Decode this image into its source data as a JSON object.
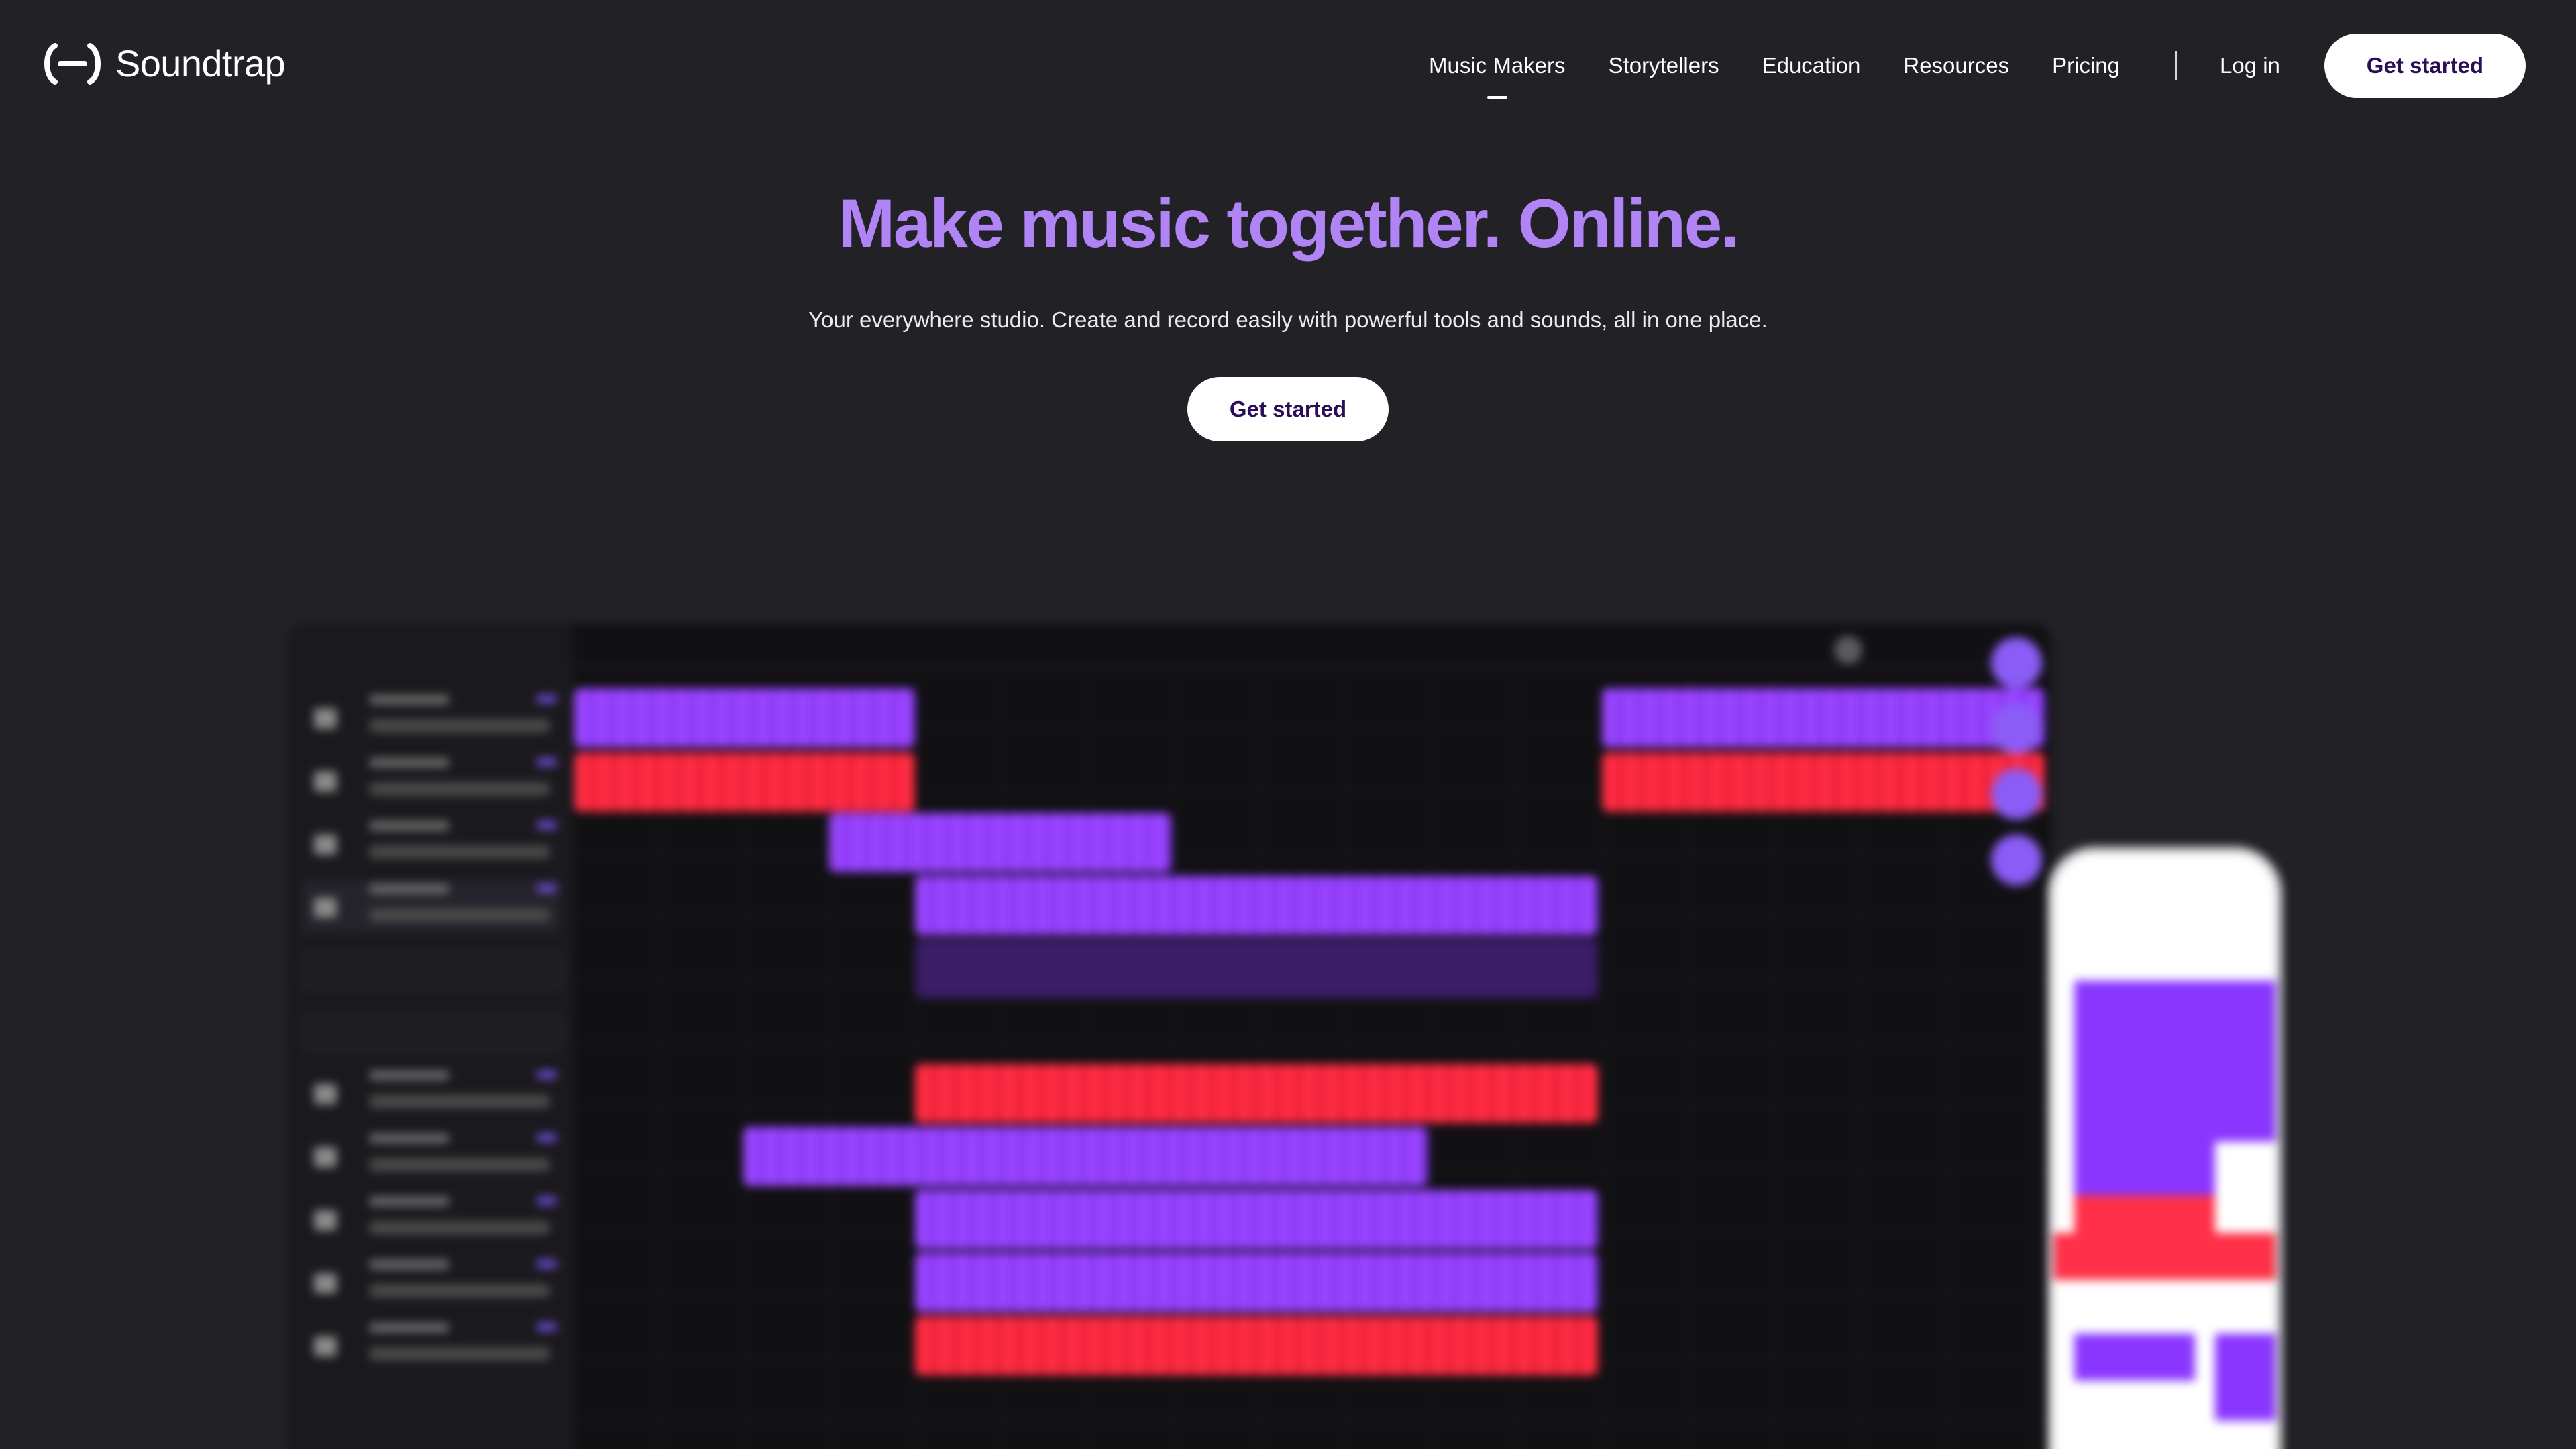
{
  "brand": {
    "name": "Soundtrap",
    "accent": "#b084f4",
    "background": "#222126",
    "clip_purple": "#9a45ff",
    "clip_red": "#ff2c43"
  },
  "nav": {
    "items": [
      {
        "label": "Music Makers",
        "active": true
      },
      {
        "label": "Storytellers",
        "active": false
      },
      {
        "label": "Education",
        "active": false
      },
      {
        "label": "Resources",
        "active": false
      },
      {
        "label": "Pricing",
        "active": false
      }
    ],
    "login_label": "Log in",
    "cta_label": "Get started"
  },
  "hero": {
    "title": "Make music together. Online.",
    "subtitle": "Your everywhere studio. Create and record easily with powerful tools and sounds, all in one place.",
    "cta_label": "Get started"
  },
  "preview": {
    "icon": "daw-app-screenshot",
    "phone_icon": "mobile-app-screenshot"
  }
}
